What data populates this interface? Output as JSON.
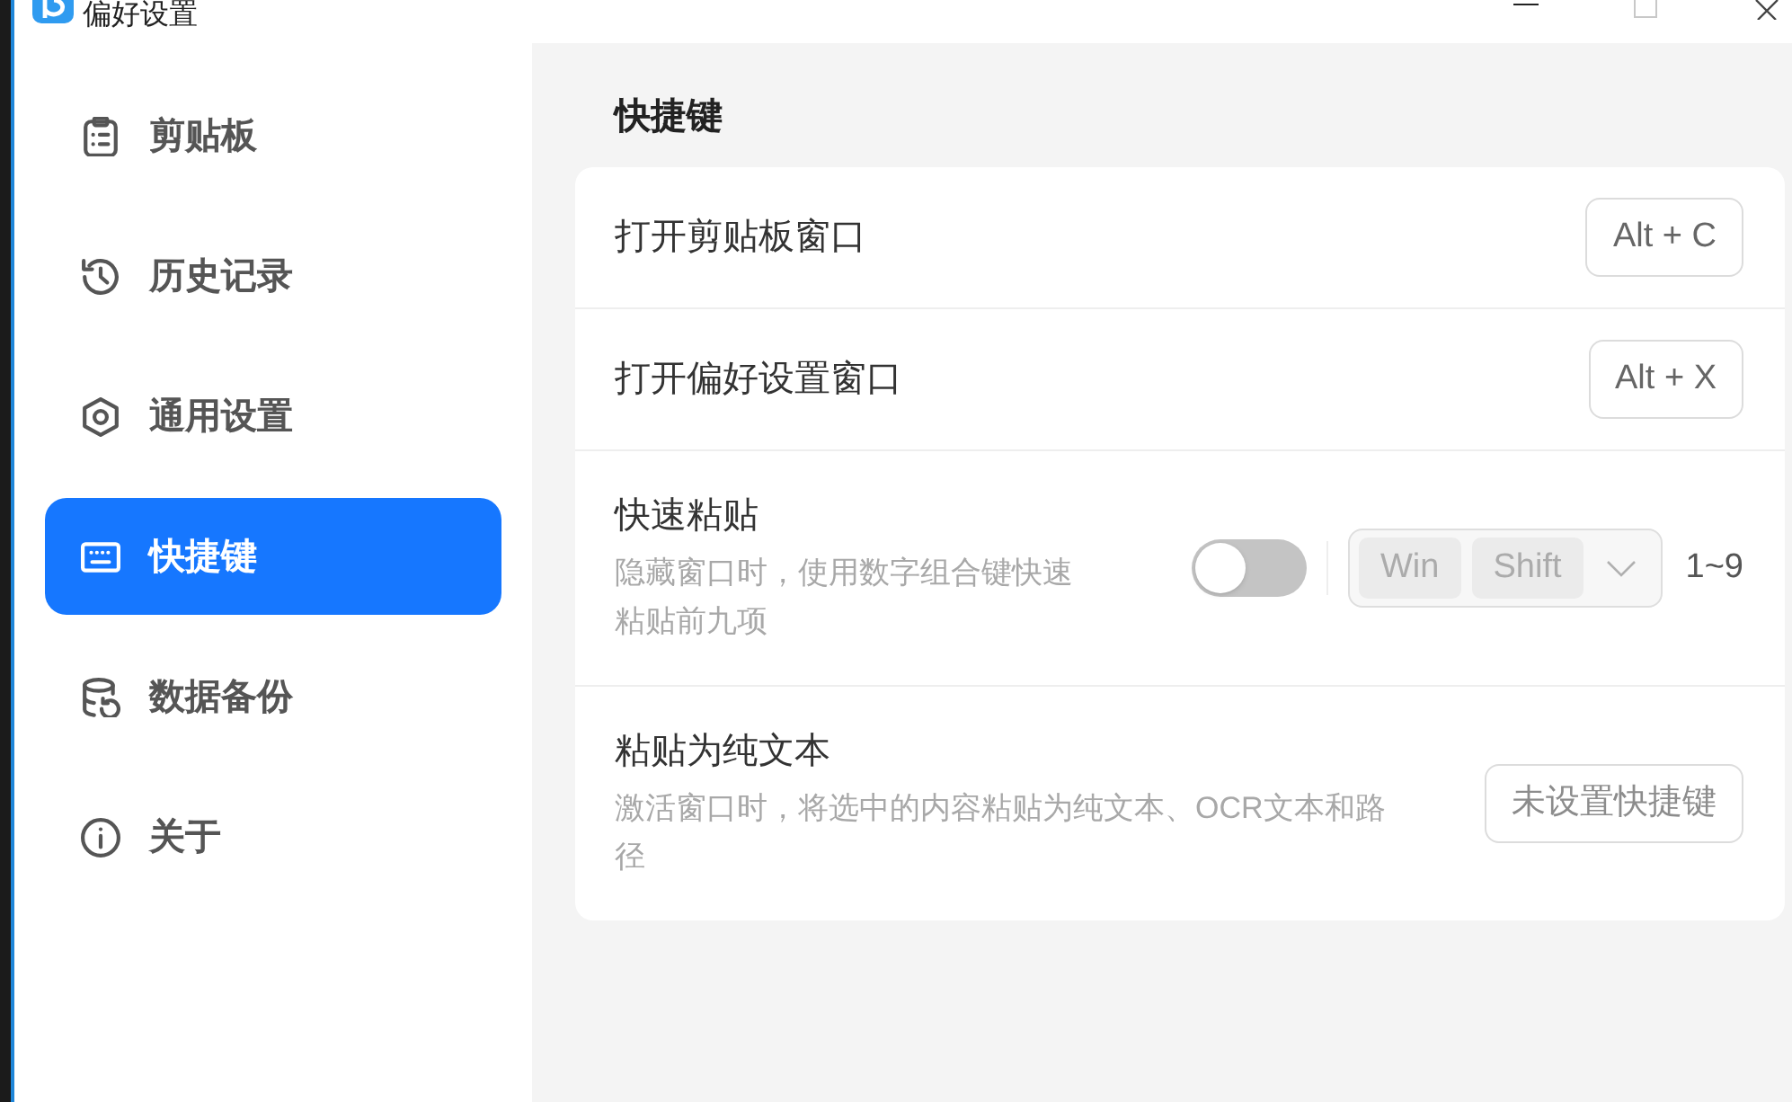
{
  "window": {
    "title": "偏好设置"
  },
  "sidebar": {
    "items": [
      {
        "label": "剪贴板",
        "selected": false
      },
      {
        "label": "历史记录",
        "selected": false
      },
      {
        "label": "通用设置",
        "selected": false
      },
      {
        "label": "快捷键",
        "selected": true
      },
      {
        "label": "数据备份",
        "selected": false
      },
      {
        "label": "关于",
        "selected": false
      }
    ]
  },
  "section_title": "快捷键",
  "settings": [
    {
      "kind": "shortcut",
      "title": "打开剪贴板窗口",
      "shortcut": "Alt + C"
    },
    {
      "kind": "shortcut",
      "title": "打开偏好设置窗口",
      "shortcut": "Alt + X"
    },
    {
      "kind": "toggle_keys",
      "title": "快速粘贴",
      "description": "隐藏窗口时，使用数字组合键快速粘贴前九项",
      "on": false,
      "select": {
        "disabled": true,
        "keys": [
          "Win",
          "Shift"
        ]
      },
      "suffix": "1~9"
    },
    {
      "kind": "shortcut",
      "title": "粘贴为纯文本",
      "description": "激活窗口时，将选中的内容粘贴为纯文本、OCR文本和路径",
      "placeholder": "未设置快捷键"
    }
  ]
}
